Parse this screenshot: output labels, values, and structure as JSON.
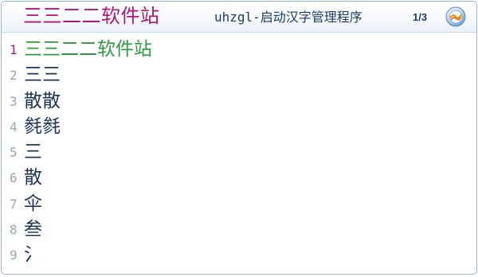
{
  "composition": {
    "text": "三三二二软件站"
  },
  "header": {
    "app_title": "uhzgl-启动汉字管理程序",
    "page_indicator": "1/3",
    "logo_icon": "ime-logo-icon"
  },
  "candidates": [
    {
      "index": "1",
      "text": "三三二二软件站",
      "selected": true
    },
    {
      "index": "2",
      "text": "三三"
    },
    {
      "index": "3",
      "text": "散散"
    },
    {
      "index": "4",
      "text": "毵毵"
    },
    {
      "index": "5",
      "text": "三"
    },
    {
      "index": "6",
      "text": "散"
    },
    {
      "index": "7",
      "text": "伞"
    },
    {
      "index": "8",
      "text": "叁"
    },
    {
      "index": "9",
      "text": "氵"
    }
  ],
  "colors": {
    "composition": "#b2167a",
    "selected_candidate": "#2c9a3f",
    "candidate_text": "#1f3659",
    "index_text": "#98a6b6",
    "window_border": "#9bb6d8"
  }
}
